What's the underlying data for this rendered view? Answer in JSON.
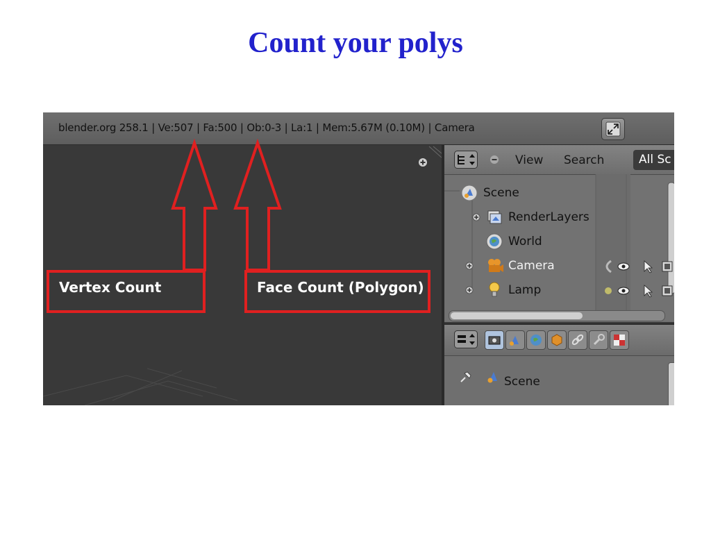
{
  "slide": {
    "title": "Count your polys"
  },
  "info_bar": {
    "text": "blender.org 258.1 | Ve:507 | Fa:500 | Ob:0-3 | La:1 | Mem:5.67M (0.10M) | Camera"
  },
  "annotations": {
    "vertex": "Vertex Count",
    "face": "Face Count (Polygon)"
  },
  "outliner": {
    "menu_view": "View",
    "menu_search": "Search",
    "filter": "All Sc",
    "items": [
      {
        "label": "Scene",
        "icon": "scene-icon"
      },
      {
        "label": "RenderLayers",
        "icon": "render-layers-icon"
      },
      {
        "label": "World",
        "icon": "world-icon"
      },
      {
        "label": "Camera",
        "icon": "camera-icon"
      },
      {
        "label": "Lamp",
        "icon": "lamp-icon"
      }
    ]
  },
  "properties": {
    "scene_label": "Scene"
  },
  "colors": {
    "title": "#2222cc",
    "annotation": "#e02020",
    "viewport": "#393939",
    "panel": "#727272"
  }
}
